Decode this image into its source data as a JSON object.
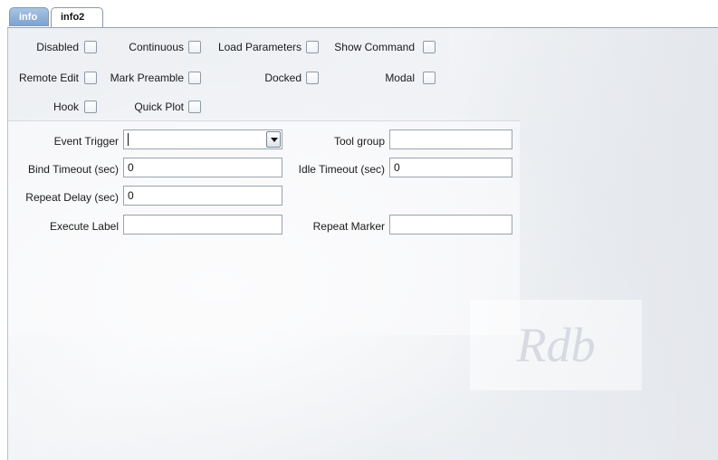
{
  "tabs": [
    {
      "label": "info"
    },
    {
      "label": "info2"
    }
  ],
  "checkboxes": {
    "disabled": {
      "label": "Disabled",
      "checked": false
    },
    "continuous": {
      "label": "Continuous",
      "checked": false
    },
    "load_parameters": {
      "label": "Load Parameters",
      "checked": false
    },
    "show_command": {
      "label": "Show Command",
      "checked": false
    },
    "remote_edit": {
      "label": "Remote Edit",
      "checked": false
    },
    "mark_preamble": {
      "label": "Mark Preamble",
      "checked": false
    },
    "docked": {
      "label": "Docked",
      "checked": false
    },
    "modal": {
      "label": "Modal",
      "checked": false
    },
    "hook": {
      "label": "Hook",
      "checked": false
    },
    "quick_plot": {
      "label": "Quick Plot",
      "checked": false
    }
  },
  "fields": {
    "event_trigger": {
      "label": "Event Trigger",
      "value": ""
    },
    "tool_group": {
      "label": "Tool group",
      "value": ""
    },
    "bind_timeout": {
      "label": "Bind Timeout (sec)",
      "value": "0"
    },
    "idle_timeout": {
      "label": "Idle Timeout (sec)",
      "value": "0"
    },
    "repeat_delay": {
      "label": "Repeat Delay (sec)",
      "value": "0"
    },
    "execute_label": {
      "label": "Execute Label",
      "value": ""
    },
    "repeat_marker": {
      "label": "Repeat Marker",
      "value": ""
    }
  },
  "watermark": {
    "text": "Rdb"
  }
}
